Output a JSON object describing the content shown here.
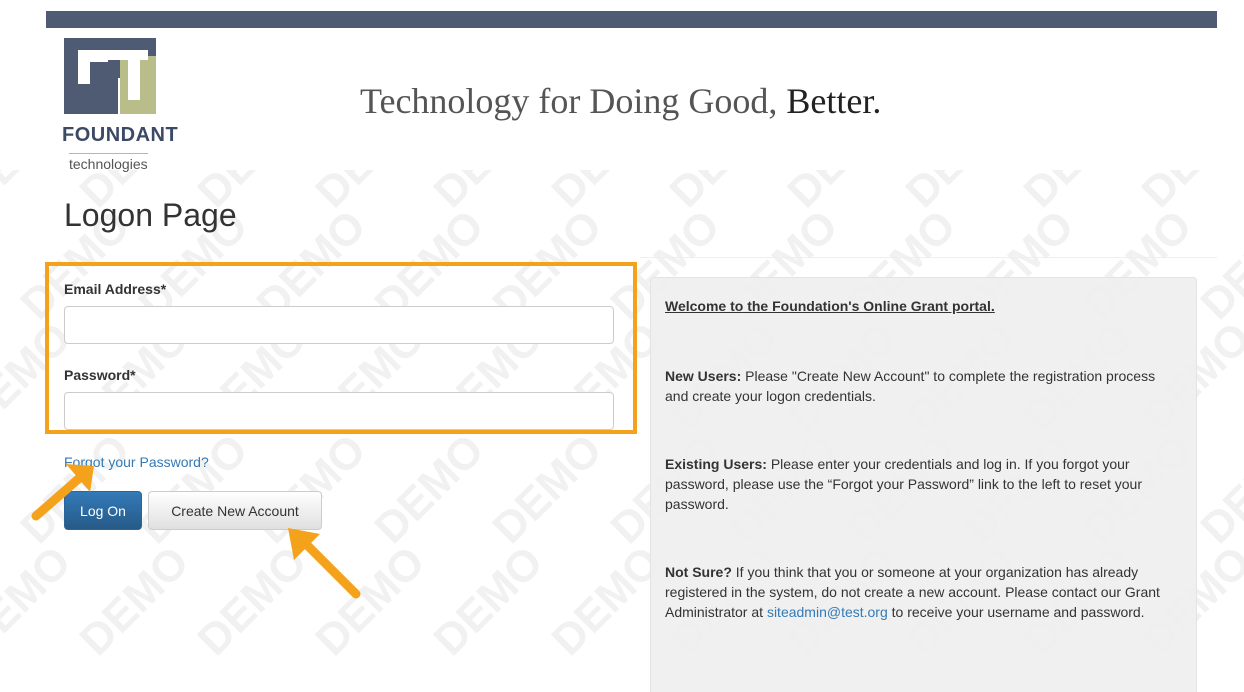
{
  "header": {
    "logo_wordmark": "FOUNDANT",
    "logo_sub": "technologies",
    "tagline_main": "Technology for Doing Good,",
    "tagline_strong": "Better."
  },
  "page": {
    "title": "Logon Page"
  },
  "form": {
    "email_label": "Email Address*",
    "email_value": "",
    "password_label": "Password*",
    "password_value": "",
    "forgot_link": "Forgot your Password?",
    "logon_button": "Log On",
    "create_account_button": "Create New Account"
  },
  "info": {
    "welcome": "Welcome to the Foundation's Online Grant portal.",
    "new_users_heading": "New Users:",
    "new_users_text": " Please \"Create New Account\" to complete the registration process and create your logon credentials.",
    "existing_users_heading": "Existing Users:",
    "existing_users_text": " Please enter your credentials and log in. If you forgot your password, please use the “Forgot your Password” link to the left to reset your password.",
    "not_sure_heading": "Not Sure?",
    "not_sure_text_before": " If you think that you or someone at your organization has already registered in the system, do not create a new account. Please contact our Grant Administrator at ",
    "not_sure_email": "siteadmin@test.org",
    "not_sure_text_after": " to receive your username and password."
  },
  "watermark": {
    "text": "DEMO"
  },
  "colors": {
    "top_bar": "#4f5b73",
    "logo_dark": "#4f5b73",
    "logo_light": "#b9bd8a",
    "highlight": "#f4a21b",
    "link": "#337ab7",
    "primary_button": "#2d6ca2"
  }
}
